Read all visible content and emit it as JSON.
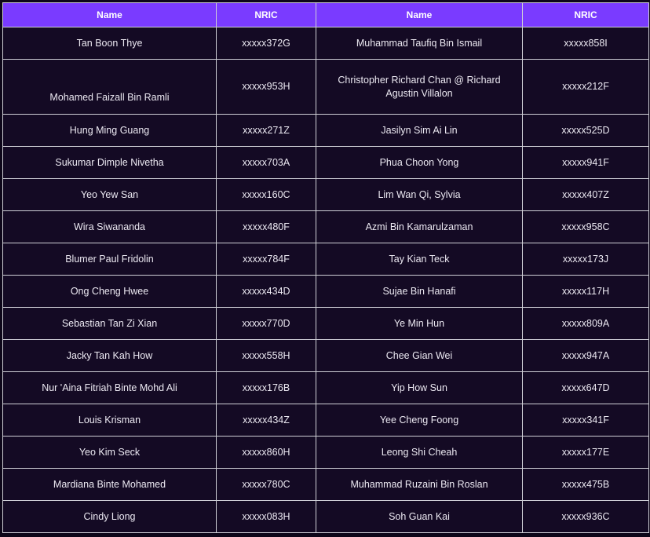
{
  "headers": [
    "Name",
    "NRIC",
    "Name",
    "NRIC"
  ],
  "rows": [
    [
      "Tan Boon Thye",
      "xxxxx372G",
      "Muhammad Taufiq Bin Ismail",
      "xxxxx858I"
    ],
    [
      "Mohamed Faizall Bin Ramli",
      "xxxxx953H",
      "Christopher Richard Chan @ Richard Agustin Villalon",
      "xxxxx212F"
    ],
    [
      "Hung Ming Guang",
      "xxxxx271Z",
      "Jasilyn Sim Ai Lin",
      "xxxxx525D"
    ],
    [
      "Sukumar Dimple Nivetha",
      "xxxxx703A",
      "Phua Choon Yong",
      "xxxxx941F"
    ],
    [
      "Yeo Yew San",
      "xxxxx160C",
      "Lim Wan Qi, Sylvia",
      "xxxxx407Z"
    ],
    [
      "Wira Siwananda",
      "xxxxx480F",
      "Azmi Bin Kamarulzaman",
      "xxxxx958C"
    ],
    [
      "Blumer Paul Fridolin",
      "xxxxx784F",
      "Tay Kian Teck",
      "xxxxx173J"
    ],
    [
      "Ong Cheng Hwee",
      "xxxxx434D",
      "Sujae Bin Hanafi",
      "xxxxx117H"
    ],
    [
      "Sebastian Tan Zi Xian",
      "xxxxx770D",
      "Ye Min Hun",
      "xxxxx809A"
    ],
    [
      "Jacky Tan Kah How",
      "xxxxx558H",
      "Chee Gian Wei",
      "xxxxx947A"
    ],
    [
      "Nur 'Aina Fitriah Binte Mohd Ali",
      "xxxxx176B",
      "Yip How Sun",
      "xxxxx647D"
    ],
    [
      "Louis Krisman",
      "xxxxx434Z",
      "Yee Cheng Foong",
      "xxxxx341F"
    ],
    [
      "Yeo Kim Seck",
      "xxxxx860H",
      "Leong Shi Cheah",
      "xxxxx177E"
    ],
    [
      "Mardiana Binte Mohamed",
      "xxxxx780C",
      "Muhammad Ruzaini Bin Roslan",
      "xxxxx475B"
    ],
    [
      "Cindy Liong",
      "xxxxx083H",
      "Soh Guan Kai",
      "xxxxx936C"
    ]
  ],
  "colors": {
    "header_bg": "#7a3bff",
    "cell_bg": "#140a24",
    "page_bg": "#0d0619",
    "border": "#cfcfd6"
  }
}
